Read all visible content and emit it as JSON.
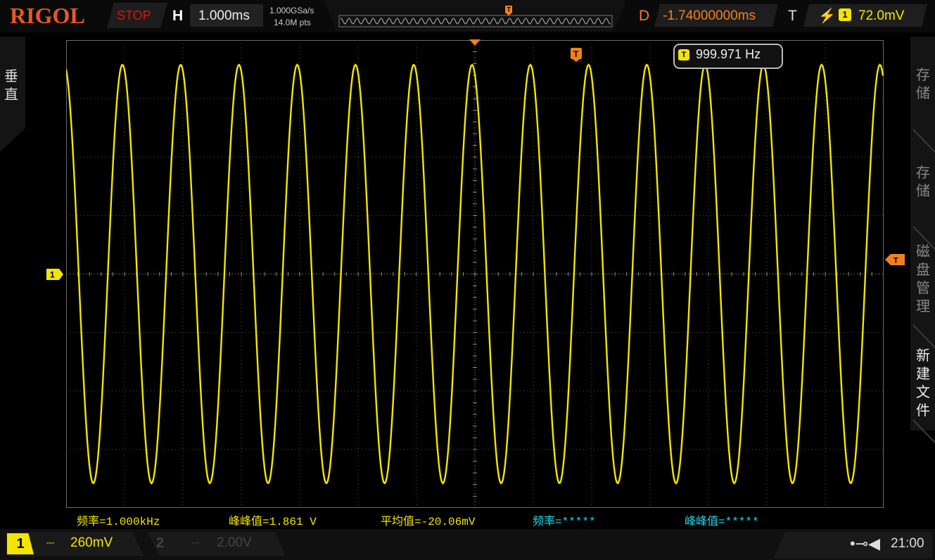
{
  "header": {
    "logo": "RIGOL",
    "run_state": "STOP",
    "horizontal_label": "H",
    "timebase": "1.000ms",
    "sample_rate": "1.000GSa/s",
    "memory_depth": "14.0M pts",
    "delay_label": "D",
    "delay": "-1.74000000ms",
    "trigger_label": "T",
    "trigger_channel": "1",
    "trigger_level": "72.0mV"
  },
  "left_panel": {
    "label": "垂直"
  },
  "right_menu": {
    "items": [
      {
        "label": "存储"
      },
      {
        "label": "存储"
      },
      {
        "label": "磁盘管理"
      },
      {
        "label": "新建文件"
      }
    ]
  },
  "frequency_badge": {
    "value": "999.971 Hz",
    "icon": "T"
  },
  "measurements": [
    {
      "text": "频率=1.000kHz",
      "color": "#f2e600"
    },
    {
      "text": "峰峰值=1.861 V",
      "color": "#f2e600"
    },
    {
      "text": "平均值=-20.06mV",
      "color": "#f2e600"
    },
    {
      "text": "频率=*****",
      "color": "#22d8e8"
    },
    {
      "text": "峰峰值=*****",
      "color": "#22d8e8"
    }
  ],
  "channels": {
    "ch1": {
      "number": "1",
      "coupling_icon": "dc-coupling-icon",
      "scale": "260mV"
    },
    "ch2": {
      "number": "2",
      "coupling_icon": "dc-coupling-icon",
      "scale": "2.00V"
    }
  },
  "status": {
    "usb_icon": "usb-icon",
    "speaker_icon": "speaker-icon",
    "time": "21:00"
  },
  "colors": {
    "ch1": "#f2e600",
    "trigger": "#f08020",
    "stop": "#e01010",
    "ch2_meas": "#22d8e8"
  },
  "waveform": {
    "type": "sine",
    "cycles_visible": 14,
    "peak_to_peak_v": 1.861,
    "volts_per_div": 0.26,
    "v_divisions": 8,
    "h_divisions": 14
  }
}
